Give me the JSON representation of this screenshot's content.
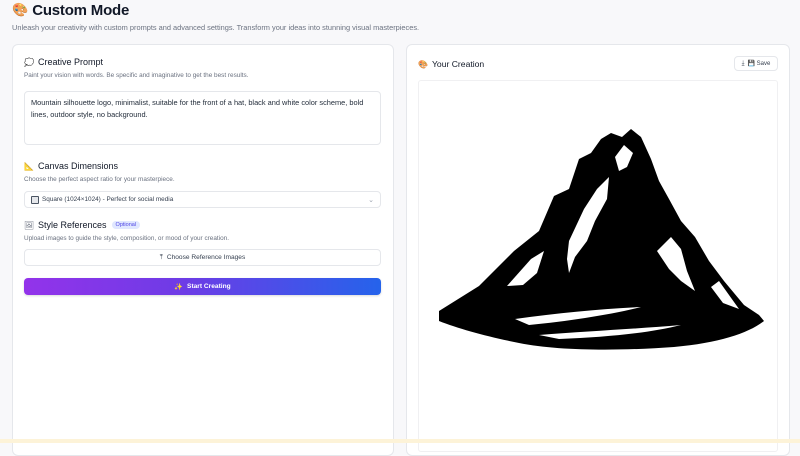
{
  "header": {
    "emoji": "🎨",
    "title": "Custom Mode",
    "subtitle": "Unleash your creativity with custom prompts and advanced settings. Transform your ideas into stunning visual masterpieces."
  },
  "prompt": {
    "icon": "speech-bubble-icon",
    "icon_glyph": "💭",
    "title": "Creative Prompt",
    "description": "Paint your vision with words. Be specific and imaginative to get the best results.",
    "value": "Mountain silhouette logo, minimalist, suitable for the front of a hat, black and white color scheme, bold lines, outdoor style, no background."
  },
  "dimensions": {
    "icon": "ruler-icon",
    "icon_glyph": "📐",
    "title": "Canvas Dimensions",
    "description": "Choose the perfect aspect ratio for your masterpiece.",
    "selected": "Square (1024×1024) - Perfect for social media",
    "chevron": "⌄"
  },
  "style_refs": {
    "icon": "image-icon",
    "icon_glyph": "🖼",
    "title": "Style References",
    "badge": "Optional",
    "description": "Upload images to guide the style, composition, or mood of your creation.",
    "button_label": "Choose Reference Images",
    "button_icon_glyph": "⤒"
  },
  "start": {
    "label": "Start Creating",
    "icon_glyph": "✨"
  },
  "creation": {
    "icon": "palette-icon",
    "icon_glyph": "🎨",
    "title": "Your Creation",
    "save_label": "💾 Save",
    "save_icon_glyph": "⤓"
  },
  "colors": {
    "accent_start": "#9333ea",
    "accent_end": "#2563eb",
    "logo": "#000000"
  }
}
